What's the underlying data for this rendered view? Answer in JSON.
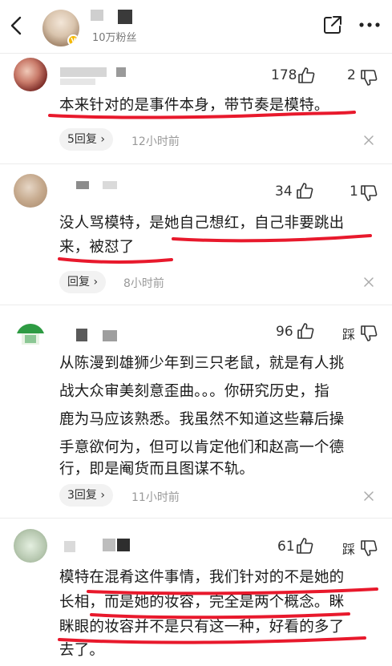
{
  "header": {
    "fans_text": "10万粉丝"
  },
  "comments": [
    {
      "likes": "178",
      "dislikes": "2",
      "text": "本来针对的是事件本身，带节奏是模特。",
      "reply_label": "5回复",
      "time": "12小时前"
    },
    {
      "likes": "34",
      "dislikes": "1",
      "text_line1": "没人骂模特，是她自己想红，自己非要跳出",
      "text_line2": "来，被怼了",
      "reply_label": "回复",
      "time": "8小时前"
    },
    {
      "likes": "96",
      "dislikes": "踩",
      "text_line1": "从陈漫到雄狮少年到三只老鼠，就是有人挑",
      "text_line2": "战大众审美刻意歪曲。。。你研究历史，指",
      "text_line3": "鹿为马应该熟悉。我虽然不知道这些幕后操",
      "text_line4": "手意欲何为，但可以肯定他们和赵高一个德",
      "text_line5": "行，即是阉货而且图谋不轨。",
      "reply_label": "3回复",
      "time": "11小时前"
    },
    {
      "likes": "61",
      "dislikes": "踩",
      "text_line1": "模特在混肴这件事情，我们针对的不是她的",
      "text_line2": "长相，而是她的妆容，完全是两个概念。眯",
      "text_line3": "眯眼的妆容并不是只有这一种，好看的多了",
      "text_line4": "去了。"
    }
  ],
  "colors": {
    "underline": "#e8192c",
    "badge": "#f5b800"
  }
}
